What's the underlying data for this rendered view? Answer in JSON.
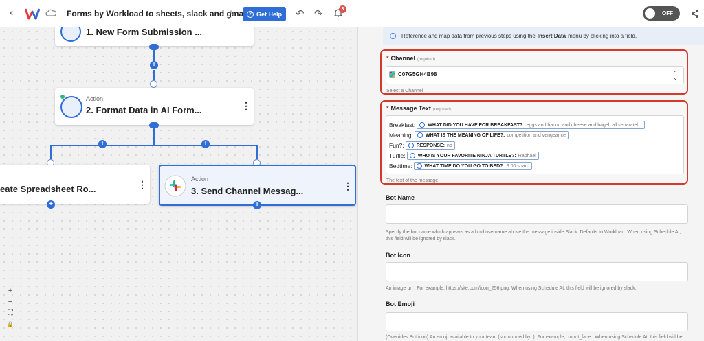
{
  "topbar": {
    "workflow_title": "Forms by Workload to sheets, slack and gmail",
    "help_label": "Get Help",
    "notification_count": "3",
    "toggle_label": "OFF"
  },
  "canvas": {
    "nodes": [
      {
        "title": "1. New Form Submission ...",
        "action": ""
      },
      {
        "title": "2. Format Data in AI Form...",
        "action": "Action"
      },
      {
        "title": "eate Spreadsheet Ro...",
        "action": ""
      },
      {
        "title": "3. Send Channel Messag...",
        "action": "Action"
      }
    ],
    "zoom": {
      "in": "+",
      "out": "−",
      "fit": "⛶",
      "lock": "🔒"
    }
  },
  "panel": {
    "info_text_prefix": "Reference and map data from previous steps using the",
    "info_text_bold": "Insert Data",
    "info_text_suffix": "menu by clicking into a field.",
    "channel": {
      "label": "Channel",
      "required": "(required)",
      "value": "C07G5GH4B98",
      "help": "Select a Channel"
    },
    "message": {
      "label": "Message Text",
      "required": "(required)",
      "help": "The text of the message",
      "lines": [
        {
          "key": "Breakfast:",
          "chip_label": "WHAT DID YOU HAVE FOR BREAKFAST?:",
          "chip_value": "eggs and bacon and cheese and bagel, all separatel..."
        },
        {
          "key": "Meaning:",
          "chip_label": "WHAT IS THE MEANING OF LIFE?:",
          "chip_value": "competition and vengeance"
        },
        {
          "key": "Fun?:",
          "chip_label": "RESPONSE:",
          "chip_value": "no"
        },
        {
          "key": "Turtle:",
          "chip_label": "WHO IS YOUR FAVORITE NINJA TURTLE?:",
          "chip_value": "Raphael"
        },
        {
          "key": "Bedtime:",
          "chip_label": "WHAT TIME DO YOU GO TO BED?:",
          "chip_value": "9:00 sharp"
        }
      ]
    },
    "bot_name": {
      "label": "Bot Name",
      "help_line1": "Specify the bot name which appears as a bold username above the message inside Slack. Defaults to Workload. When using Schedule At,",
      "help_line2": "this field will be ignored by slack."
    },
    "bot_icon": {
      "label": "Bot Icon",
      "help": "An image url . For example, https://site.com/icon_256.png. When using Schedule At, this field will be ignored by slack."
    },
    "bot_emoji": {
      "label": "Bot Emoji",
      "help": "(Overrides Bot icon) An emoji available to your team (surrounded by :). For example, :robot_face:. When using Schedule At, this field will be"
    }
  },
  "colors": {
    "accent": "#2f6ed6",
    "highlight": "#d33a2c"
  }
}
